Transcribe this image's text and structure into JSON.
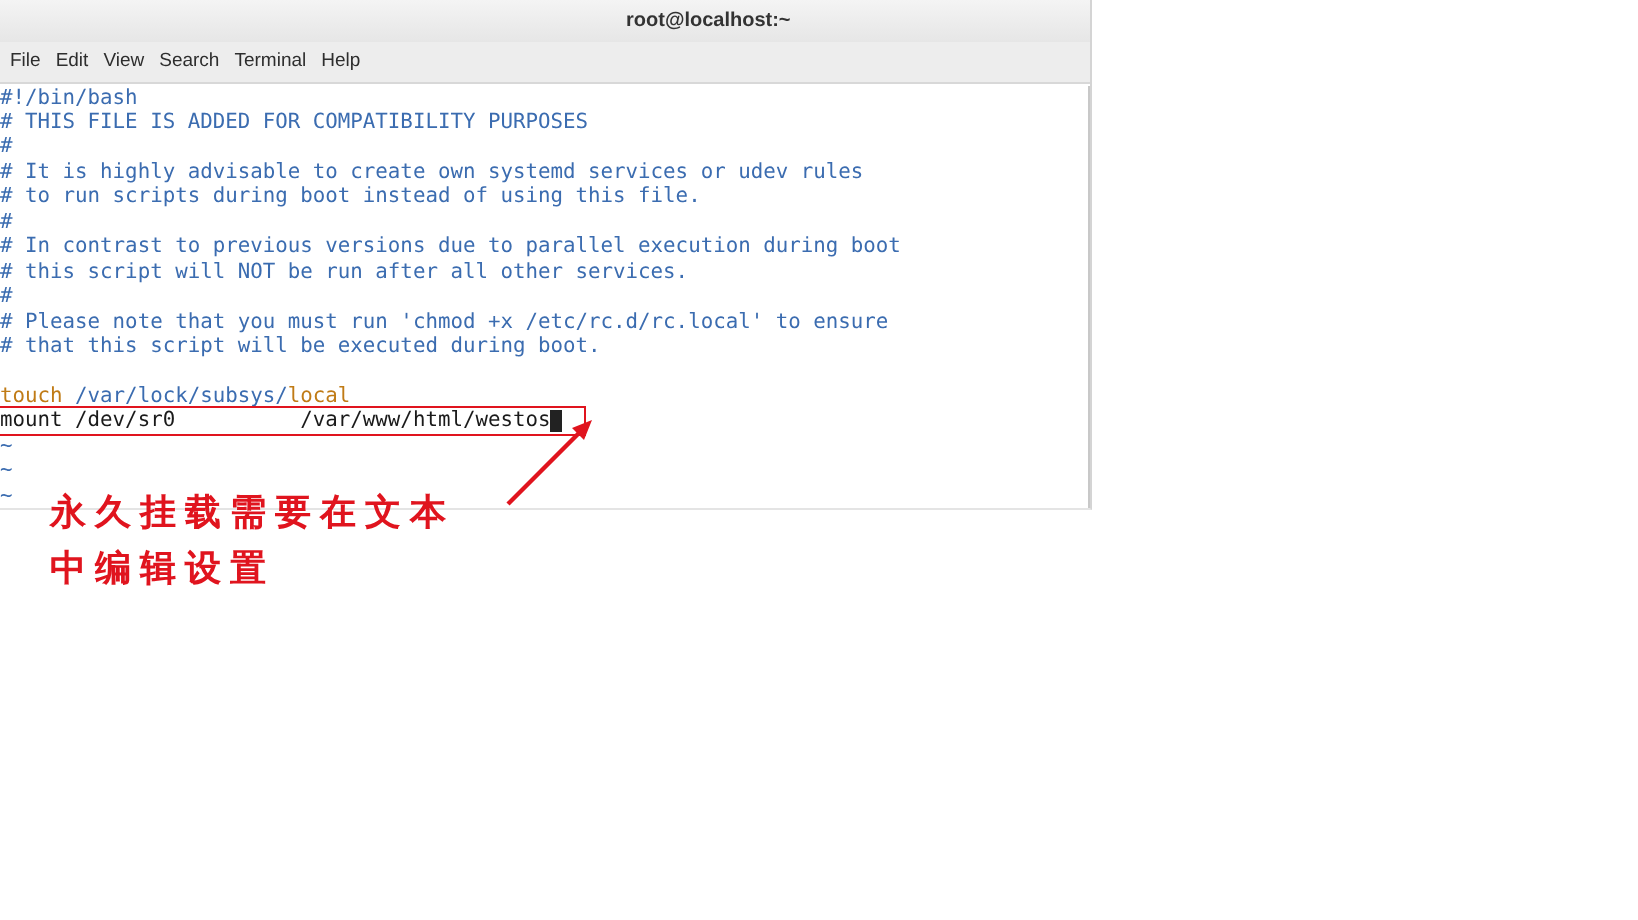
{
  "window": {
    "title": "root@localhost:~"
  },
  "menu": [
    "File",
    "Edit",
    "View",
    "Search",
    "Terminal",
    "Help"
  ],
  "editor": {
    "lines": [
      {
        "kind": "code",
        "segments": [
          {
            "text": "#!/bin/bash",
            "kind": "comment"
          }
        ]
      },
      {
        "kind": "code",
        "segments": [
          {
            "text": "# THIS FILE IS ADDED FOR COMPATIBILITY PURPOSES",
            "kind": "comment"
          }
        ]
      },
      {
        "kind": "code",
        "segments": [
          {
            "text": "#",
            "kind": "comment"
          }
        ]
      },
      {
        "kind": "code",
        "segments": [
          {
            "text": "# It is highly advisable to create own systemd services or udev rules",
            "kind": "comment"
          }
        ]
      },
      {
        "kind": "code",
        "segments": [
          {
            "text": "# to run scripts during boot instead of using this file.",
            "kind": "comment"
          }
        ]
      },
      {
        "kind": "code",
        "segments": [
          {
            "text": "#",
            "kind": "comment"
          }
        ]
      },
      {
        "kind": "code",
        "segments": [
          {
            "text": "# In contrast to previous versions due to parallel execution during boot",
            "kind": "comment"
          }
        ]
      },
      {
        "kind": "code",
        "segments": [
          {
            "text": "# this script will NOT be run after all other services.",
            "kind": "comment"
          }
        ]
      },
      {
        "kind": "code",
        "segments": [
          {
            "text": "#",
            "kind": "comment"
          }
        ]
      },
      {
        "kind": "code",
        "segments": [
          {
            "text": "# Please note that you must run 'chmod +x /etc/rc.d/rc.local' to ensure",
            "kind": "comment"
          }
        ]
      },
      {
        "kind": "code",
        "segments": [
          {
            "text": "# that this script will be executed during boot.",
            "kind": "comment"
          }
        ]
      },
      {
        "kind": "blank"
      },
      {
        "kind": "code",
        "segments": [
          {
            "text": "touch",
            "kind": "keyword"
          },
          {
            "text": " /var/lock/subsys/",
            "kind": "path"
          },
          {
            "text": "local",
            "kind": "keyword"
          }
        ]
      },
      {
        "kind": "code",
        "highlighted": true,
        "cursor": true,
        "segments": [
          {
            "text": "mount /dev/sr0          /var/www/html/westos",
            "kind": "plain"
          }
        ]
      },
      {
        "kind": "filler",
        "text": "~"
      },
      {
        "kind": "filler",
        "text": "~"
      },
      {
        "kind": "filler",
        "text": "~"
      }
    ]
  },
  "annotation": {
    "text": "永久挂载需要在文本中编辑设置"
  }
}
